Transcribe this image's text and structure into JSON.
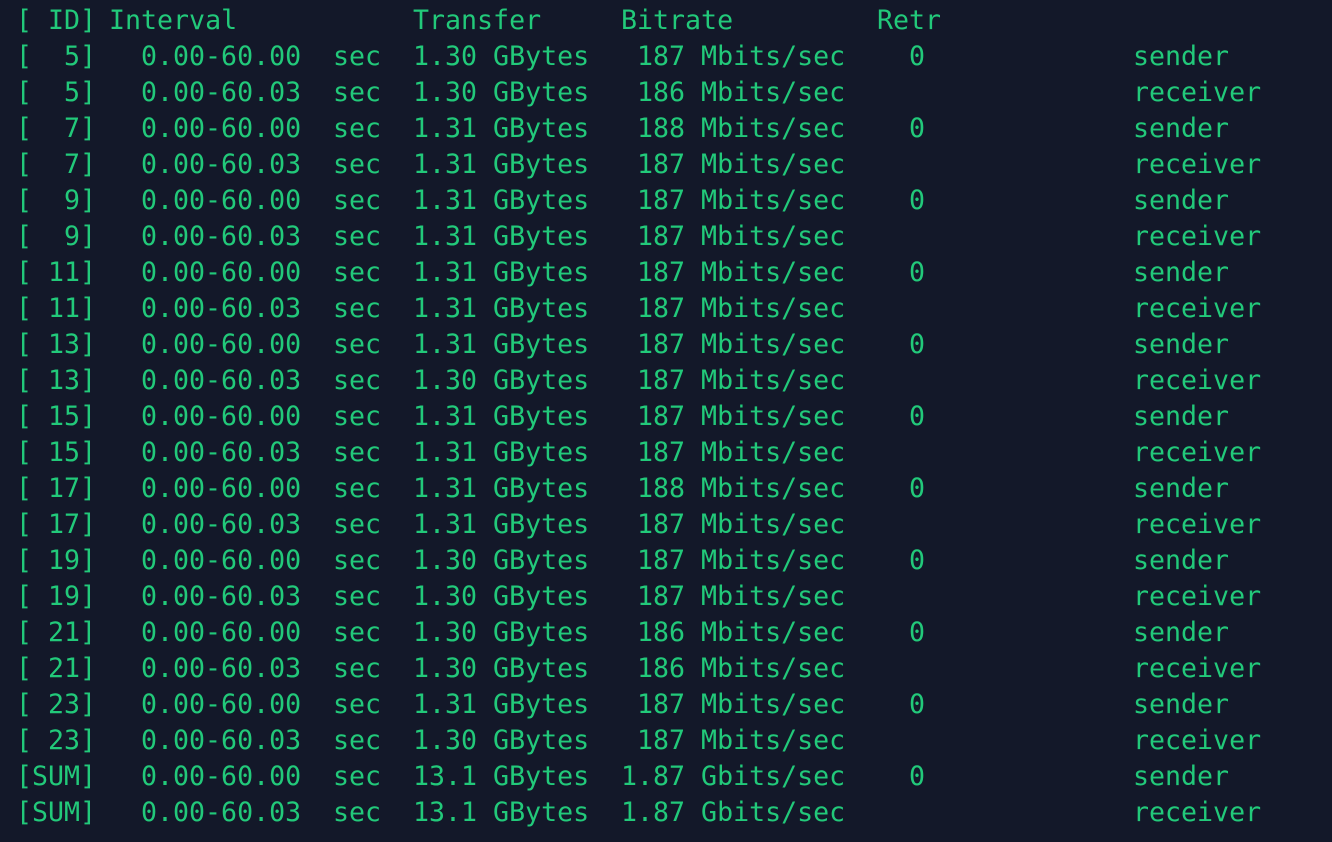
{
  "header": {
    "id": "[ ID]",
    "interval": "Interval",
    "transfer": "Transfer",
    "bitrate": "Bitrate",
    "retr": "Retr"
  },
  "rows": [
    {
      "id": "[  5]",
      "interval": "0.00-60.00",
      "unit": "sec",
      "transfer": "1.30 GBytes",
      "bitrate": " 187 Mbits/sec",
      "retr": "0",
      "role": "sender"
    },
    {
      "id": "[  5]",
      "interval": "0.00-60.03",
      "unit": "sec",
      "transfer": "1.30 GBytes",
      "bitrate": " 186 Mbits/sec",
      "retr": "",
      "role": "receiver"
    },
    {
      "id": "[  7]",
      "interval": "0.00-60.00",
      "unit": "sec",
      "transfer": "1.31 GBytes",
      "bitrate": " 188 Mbits/sec",
      "retr": "0",
      "role": "sender"
    },
    {
      "id": "[  7]",
      "interval": "0.00-60.03",
      "unit": "sec",
      "transfer": "1.31 GBytes",
      "bitrate": " 187 Mbits/sec",
      "retr": "",
      "role": "receiver"
    },
    {
      "id": "[  9]",
      "interval": "0.00-60.00",
      "unit": "sec",
      "transfer": "1.31 GBytes",
      "bitrate": " 187 Mbits/sec",
      "retr": "0",
      "role": "sender"
    },
    {
      "id": "[  9]",
      "interval": "0.00-60.03",
      "unit": "sec",
      "transfer": "1.31 GBytes",
      "bitrate": " 187 Mbits/sec",
      "retr": "",
      "role": "receiver"
    },
    {
      "id": "[ 11]",
      "interval": "0.00-60.00",
      "unit": "sec",
      "transfer": "1.31 GBytes",
      "bitrate": " 187 Mbits/sec",
      "retr": "0",
      "role": "sender"
    },
    {
      "id": "[ 11]",
      "interval": "0.00-60.03",
      "unit": "sec",
      "transfer": "1.31 GBytes",
      "bitrate": " 187 Mbits/sec",
      "retr": "",
      "role": "receiver"
    },
    {
      "id": "[ 13]",
      "interval": "0.00-60.00",
      "unit": "sec",
      "transfer": "1.31 GBytes",
      "bitrate": " 187 Mbits/sec",
      "retr": "0",
      "role": "sender"
    },
    {
      "id": "[ 13]",
      "interval": "0.00-60.03",
      "unit": "sec",
      "transfer": "1.30 GBytes",
      "bitrate": " 187 Mbits/sec",
      "retr": "",
      "role": "receiver"
    },
    {
      "id": "[ 15]",
      "interval": "0.00-60.00",
      "unit": "sec",
      "transfer": "1.31 GBytes",
      "bitrate": " 187 Mbits/sec",
      "retr": "0",
      "role": "sender"
    },
    {
      "id": "[ 15]",
      "interval": "0.00-60.03",
      "unit": "sec",
      "transfer": "1.31 GBytes",
      "bitrate": " 187 Mbits/sec",
      "retr": "",
      "role": "receiver"
    },
    {
      "id": "[ 17]",
      "interval": "0.00-60.00",
      "unit": "sec",
      "transfer": "1.31 GBytes",
      "bitrate": " 188 Mbits/sec",
      "retr": "0",
      "role": "sender"
    },
    {
      "id": "[ 17]",
      "interval": "0.00-60.03",
      "unit": "sec",
      "transfer": "1.31 GBytes",
      "bitrate": " 187 Mbits/sec",
      "retr": "",
      "role": "receiver"
    },
    {
      "id": "[ 19]",
      "interval": "0.00-60.00",
      "unit": "sec",
      "transfer": "1.30 GBytes",
      "bitrate": " 187 Mbits/sec",
      "retr": "0",
      "role": "sender"
    },
    {
      "id": "[ 19]",
      "interval": "0.00-60.03",
      "unit": "sec",
      "transfer": "1.30 GBytes",
      "bitrate": " 187 Mbits/sec",
      "retr": "",
      "role": "receiver"
    },
    {
      "id": "[ 21]",
      "interval": "0.00-60.00",
      "unit": "sec",
      "transfer": "1.30 GBytes",
      "bitrate": " 186 Mbits/sec",
      "retr": "0",
      "role": "sender"
    },
    {
      "id": "[ 21]",
      "interval": "0.00-60.03",
      "unit": "sec",
      "transfer": "1.30 GBytes",
      "bitrate": " 186 Mbits/sec",
      "retr": "",
      "role": "receiver"
    },
    {
      "id": "[ 23]",
      "interval": "0.00-60.00",
      "unit": "sec",
      "transfer": "1.31 GBytes",
      "bitrate": " 187 Mbits/sec",
      "retr": "0",
      "role": "sender"
    },
    {
      "id": "[ 23]",
      "interval": "0.00-60.03",
      "unit": "sec",
      "transfer": "1.30 GBytes",
      "bitrate": " 187 Mbits/sec",
      "retr": "",
      "role": "receiver"
    },
    {
      "id": "[SUM]",
      "interval": "0.00-60.00",
      "unit": "sec",
      "transfer": "13.1 GBytes",
      "bitrate": "1.87 Gbits/sec",
      "retr": "0",
      "role": "sender"
    },
    {
      "id": "[SUM]",
      "interval": "0.00-60.03",
      "unit": "sec",
      "transfer": "13.1 GBytes",
      "bitrate": "1.87 Gbits/sec",
      "retr": "",
      "role": "receiver"
    }
  ],
  "colors": {
    "background": "#131829",
    "text": "#22c97a"
  }
}
